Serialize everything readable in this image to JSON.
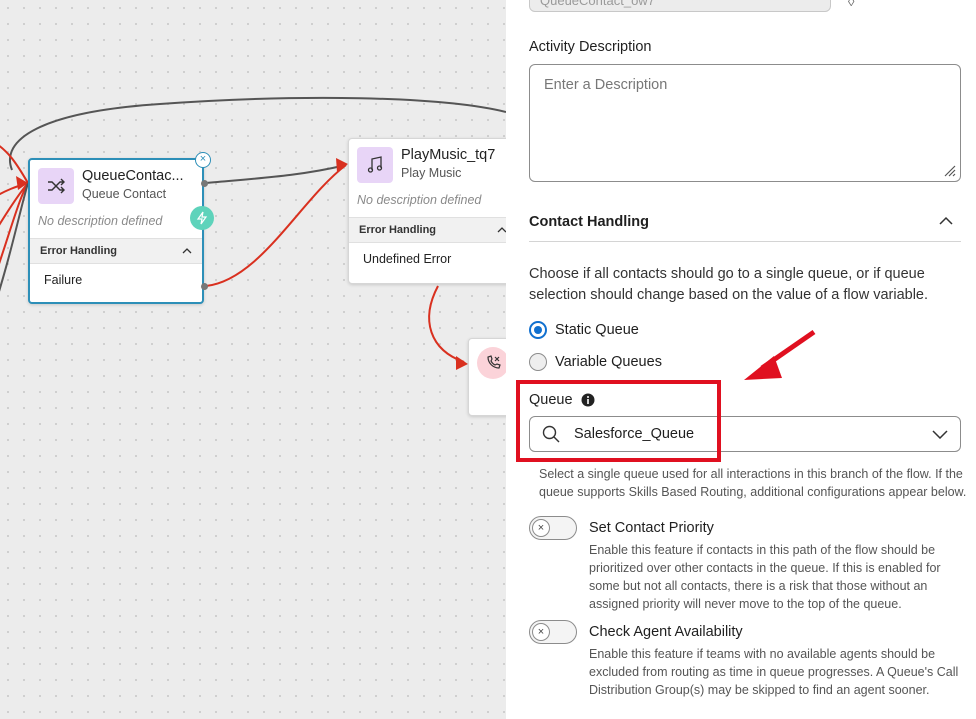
{
  "canvas": {
    "nodes": [
      {
        "title": "QueueContac...",
        "subtitle": "Queue Contact",
        "description": "No description defined",
        "error_handling": "Error Handling",
        "error_item": "Failure"
      },
      {
        "title": "PlayMusic_tq7",
        "subtitle": "Play Music",
        "description": "No description defined",
        "error_handling": "Error Handling",
        "error_item": "Undefined Error"
      }
    ],
    "colors": {
      "wire": "#555555",
      "error_wire": "#d9301f",
      "selected": "#2d8fb8",
      "node_icon_bg": "#e8d5f7"
    }
  },
  "panel": {
    "top_input_value": "QueueContact_ow7",
    "activity_description_label": "Activity Description",
    "activity_description_placeholder": "Enter a Description",
    "contact_handling_title": "Contact Handling",
    "contact_handling_text": "Choose if all contacts should go to a single queue, or if queue selection should change based on the value of a flow variable.",
    "radios": [
      {
        "label": "Static Queue",
        "selected": true
      },
      {
        "label": "Variable Queues",
        "selected": false
      }
    ],
    "queue_label": "Queue",
    "queue_value": "Salesforce_Queue",
    "queue_help": "Select a single queue used for all interactions in this branch of the flow. If the queue supports Skills Based Routing, additional configurations appear below.",
    "toggles": [
      {
        "title": "Set Contact Priority",
        "enabled": false,
        "description": "Enable this feature if contacts in this path of the flow should be prioritized over other contacts in the queue. If this is enabled for some but not all contacts, there is a risk that those without an assigned priority will never move to the top of the queue."
      },
      {
        "title": "Check Agent Availability",
        "enabled": false,
        "description": "Enable this feature if teams with no available agents should be excluded from routing as time in queue progresses. A Queue's Call Distribution Group(s) may be skipped to find an agent sooner."
      }
    ],
    "colors": {
      "accent": "#1170cf",
      "annotation": "#e01020"
    }
  }
}
